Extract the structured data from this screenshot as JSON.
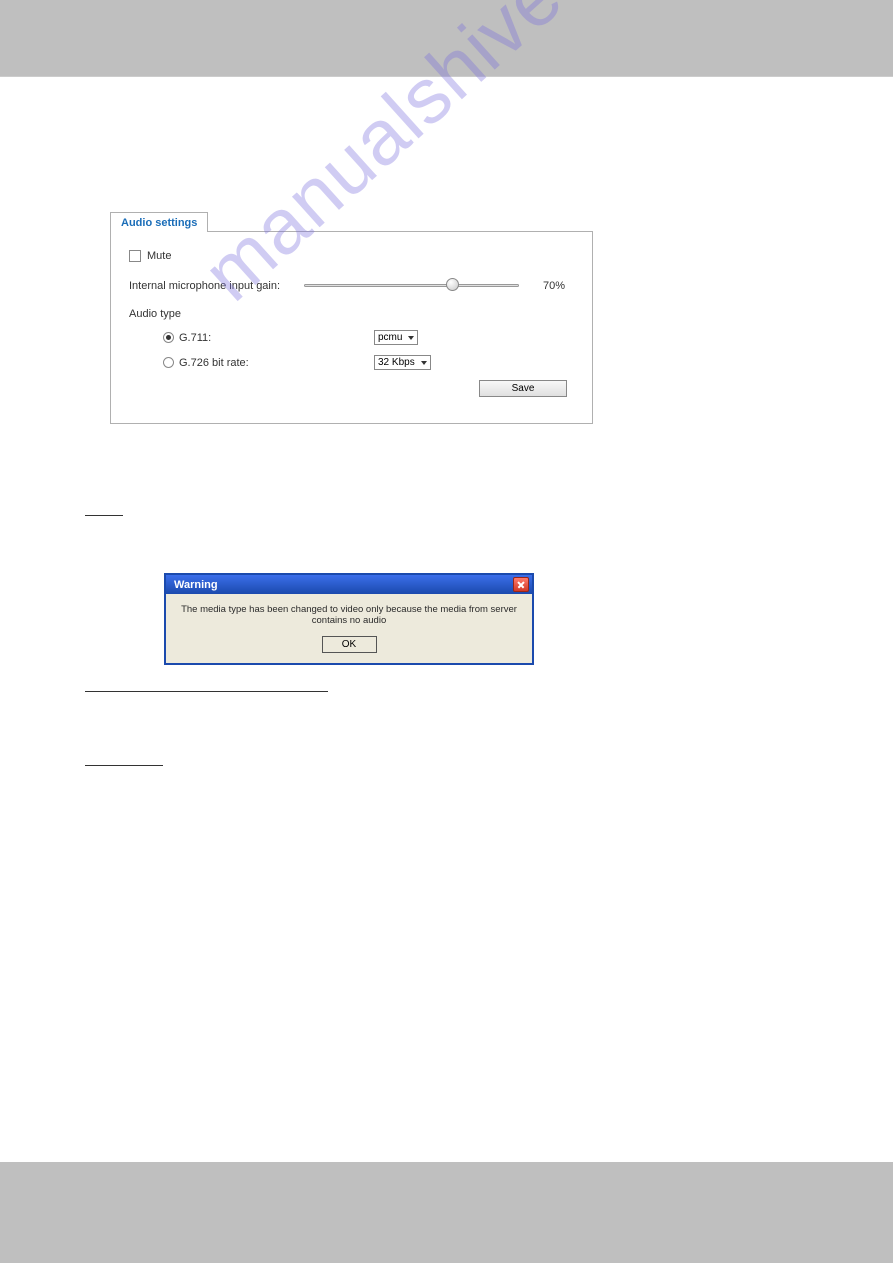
{
  "settings": {
    "tab_label": "Audio settings",
    "mute_label": "Mute",
    "gain_label": "Internal microphone input gain:",
    "gain_value": "70%",
    "audio_type_label": "Audio type",
    "g711_label": "G.711:",
    "g711_select": "pcmu",
    "g726_label": "G.726 bit rate:",
    "g726_select": "32 Kbps",
    "save_label": "Save"
  },
  "dialog": {
    "title": "Warning",
    "message": "The media type has been changed to video only because the media from server contains no audio",
    "ok_label": "OK"
  },
  "watermark": "manualshive.com"
}
